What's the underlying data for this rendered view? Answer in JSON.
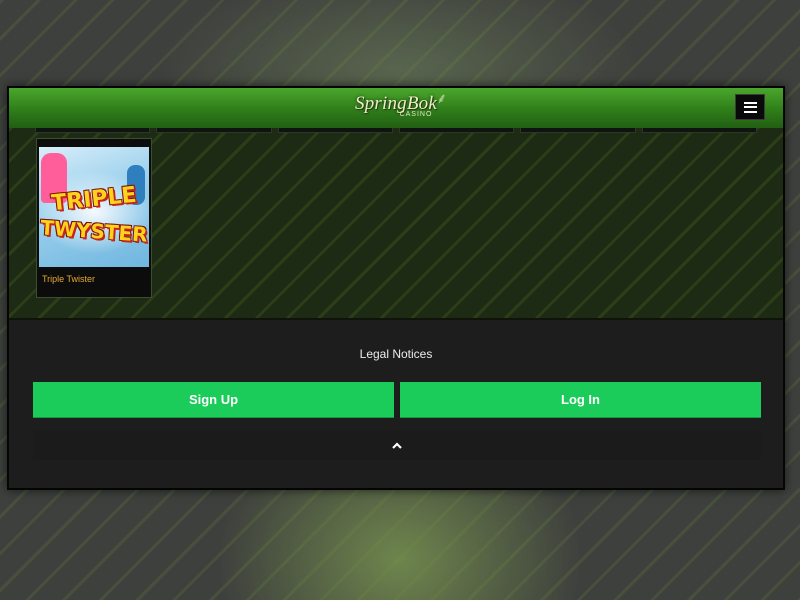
{
  "brand": {
    "logo_text": "SpringBok",
    "logo_sub": "CASINO"
  },
  "header": {
    "menu_icon": "hamburger-menu-icon"
  },
  "games": [
    {
      "name": "Triple Twister",
      "thumb_line1": "TRIPLE",
      "thumb_line2": "TWYSTER"
    }
  ],
  "footer": {
    "legal_notices": "Legal Notices",
    "sign_up": "Sign Up",
    "log_in": "Log In",
    "scroll_top_icon": "chevron-up-icon"
  },
  "colors": {
    "header_green": "#3a8f22",
    "button_green": "#1bcc5a",
    "game_label": "#e8a830",
    "footer_bg": "#1c1d1c"
  }
}
